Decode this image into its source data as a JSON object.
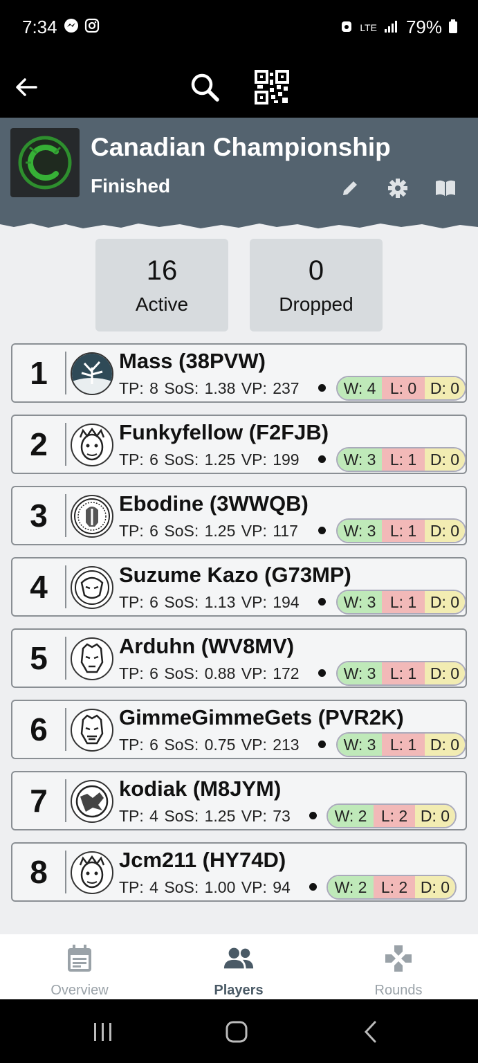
{
  "status_bar": {
    "time": "7:34",
    "network": "LTE",
    "battery": "79%"
  },
  "event": {
    "title": "Canadian Championship",
    "status": "Finished"
  },
  "stats": [
    {
      "value": "16",
      "label": "Active"
    },
    {
      "value": "0",
      "label": "Dropped"
    }
  ],
  "players": [
    {
      "rank": "1",
      "name": "Mass (38PVW)",
      "stats": "TP: 8  SoS: 1.38  VP: 237",
      "w": "W: 4",
      "l": "L: 0",
      "d": "D: 0"
    },
    {
      "rank": "2",
      "name": "Funkyfellow (F2FJB)",
      "stats": "TP: 6  SoS: 1.25  VP: 199",
      "w": "W: 3",
      "l": "L: 1",
      "d": "D: 0"
    },
    {
      "rank": "3",
      "name": "Ebodine (3WWQB)",
      "stats": "TP: 6  SoS: 1.25  VP: 117",
      "w": "W: 3",
      "l": "L: 1",
      "d": "D: 0"
    },
    {
      "rank": "4",
      "name": "Suzume Kazo (G73MP)",
      "stats": "TP: 6  SoS: 1.13  VP: 194",
      "w": "W: 3",
      "l": "L: 1",
      "d": "D: 0"
    },
    {
      "rank": "5",
      "name": "Arduhn (WV8MV)",
      "stats": "TP: 6  SoS: 0.88  VP: 172",
      "w": "W: 3",
      "l": "L: 1",
      "d": "D: 0"
    },
    {
      "rank": "6",
      "name": "GimmeGimmeGets (PVR2K)",
      "stats": "TP: 6  SoS: 0.75  VP: 213",
      "w": "W: 3",
      "l": "L: 1",
      "d": "D: 0"
    },
    {
      "rank": "7",
      "name": "kodiak (M8JYM)",
      "stats": "TP: 4  SoS: 1.25  VP: 73",
      "w": "W: 2",
      "l": "L: 2",
      "d": "D: 0"
    },
    {
      "rank": "8",
      "name": "Jcm211 (HY74D)",
      "stats": "TP: 4  SoS: 1.00  VP: 94",
      "w": "W: 2",
      "l": "L: 2",
      "d": "D: 0"
    }
  ],
  "nav": [
    {
      "label": "Overview",
      "icon": "calendar-icon"
    },
    {
      "label": "Players",
      "icon": "people-icon"
    },
    {
      "label": "Rounds",
      "icon": "rounds-icon"
    }
  ],
  "colors": {
    "header": "#54636f",
    "win": "#bfe9b9",
    "loss": "#f2b9b8",
    "draw": "#f2ecb2",
    "active_nav": "#4a5a66"
  }
}
